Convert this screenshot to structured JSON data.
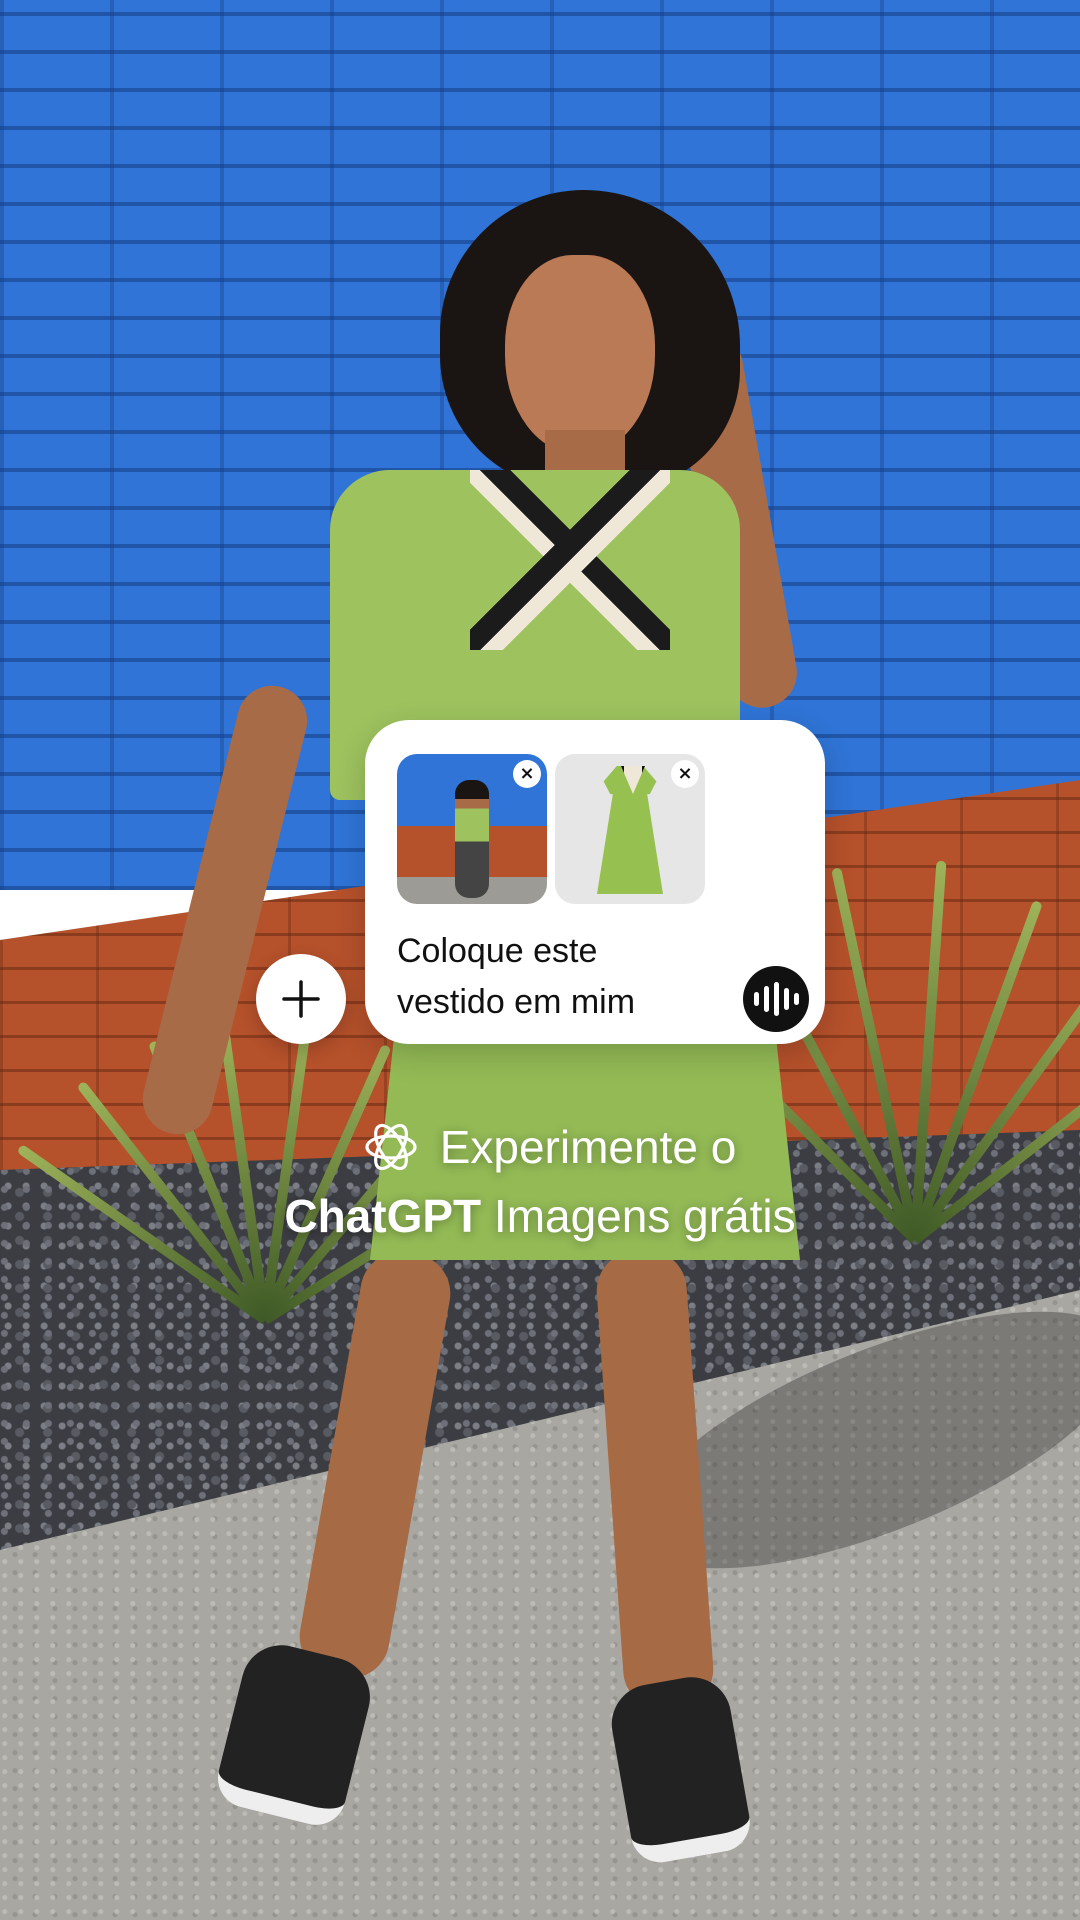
{
  "prompt_card": {
    "attachments": [
      {
        "name": "reference photo"
      },
      {
        "name": "dress product image"
      }
    ],
    "remove_label": "×",
    "prompt_line1": "Coloque este",
    "prompt_line2": "vestido em mim"
  },
  "buttons": {
    "add_icon": "plus-icon",
    "voice_icon": "voice-waveform-icon"
  },
  "caption": {
    "line1": "Experimente o",
    "brand": "ChatGPT",
    "line2_rest": " Imagens grátis",
    "logo_icon": "openai-logo-icon"
  },
  "colors": {
    "wall_blue": "#2f74d6",
    "brick": "#b5512b",
    "dress_green": "#9dc25e",
    "card_bg": "#ffffff",
    "voice_button": "#111111",
    "caption_text": "#ffffff"
  }
}
